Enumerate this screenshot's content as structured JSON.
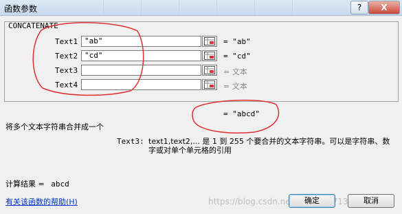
{
  "window": {
    "title": "函数参数",
    "help_label": "?",
    "close_label": "X"
  },
  "function": {
    "name": "CONCATENATE"
  },
  "args": [
    {
      "label": "Text1",
      "value": "\"ab\"",
      "result": "= \"ab\""
    },
    {
      "label": "Text2",
      "value": "\"cd\"",
      "result": "= \"cd\""
    },
    {
      "label": "Text3",
      "value": "",
      "result": "= 文本"
    },
    {
      "label": "Text4",
      "value": "",
      "result": "= 文本"
    }
  ],
  "overall_result": "= \"abcd\"",
  "description": "将多个文本字符串合并成一个",
  "param_help": {
    "label": "Text3:",
    "text": "text1,text2,... 是 1 到 255 个要合并的文本字符串。可以是字符串、数字或对单个单元格的引用"
  },
  "calc_result": {
    "label": "计算结果 =",
    "value": "abcd"
  },
  "help_link": "有关该函数的帮助(H)",
  "buttons": {
    "ok": "确定",
    "cancel": "取消"
  },
  "watermark": "https://blog.csdn.net/weixin_47136641"
}
